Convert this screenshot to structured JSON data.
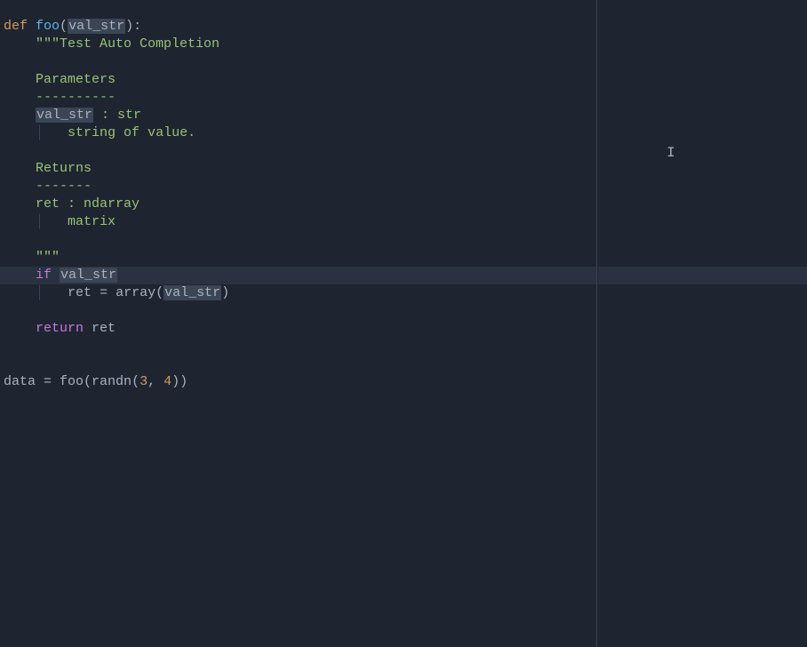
{
  "editor": {
    "cursor_glyph": "I",
    "lines": {
      "l1_def": "def",
      "l1_fn": "foo",
      "l1_open": "(",
      "l1_param": "val_str",
      "l1_close": "):",
      "l2_docstring": "\"\"\"Test Auto Completion",
      "l4_params": "Parameters",
      "l5_dashes": "----------",
      "l6_param": "val_str",
      "l6_rest": " : str",
      "l7_desc": "string of value.",
      "l9_returns": "Returns",
      "l10_dashes": "-------",
      "l11_ret": "ret : ndarray",
      "l12_matrix": "matrix",
      "l14_triple": "\"\"\"",
      "l15_if": "if",
      "l15_var": "val_str",
      "l16_ret": "ret",
      "l16_eq": " = ",
      "l16_array": "array",
      "l16_open": "(",
      "l16_param": "val_str",
      "l16_close": ")",
      "l18_return": "return",
      "l18_ret": " ret",
      "l21_data": "data = ",
      "l21_foo": "foo",
      "l21_open": "(",
      "l21_randn": "randn",
      "l21_open2": "(",
      "l21_n1": "3",
      "l21_comma": ",",
      "l21_n2": " 4",
      "l21_close": "))"
    }
  }
}
